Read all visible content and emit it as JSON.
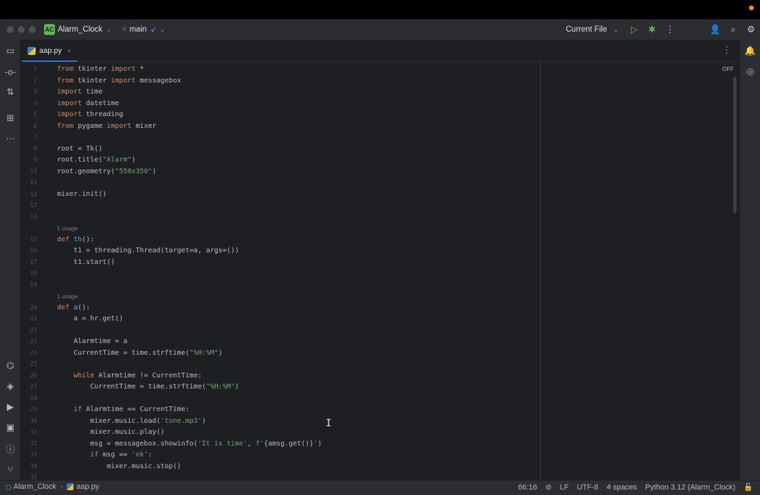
{
  "project": {
    "badge": "AC",
    "name": "Alarm_Clock"
  },
  "vcs": {
    "branch": "main"
  },
  "run_config": {
    "label": "Current File"
  },
  "tab": {
    "filename": "aap.py",
    "close": "×"
  },
  "editor": {
    "off_label": "OFF",
    "usage_hint": "1 usage",
    "lines": [
      {
        "n": "1",
        "html": "<span class='kw'>from</span> tkinter <span class='kw'>import</span> *"
      },
      {
        "n": "2",
        "html": "<span class='kw'>from</span> tkinter <span class='kw'>import</span> messagebox"
      },
      {
        "n": "3",
        "html": "<span class='kw'>import</span> time"
      },
      {
        "n": "4",
        "html": "<span class='kw'>import</span> datetime"
      },
      {
        "n": "5",
        "html": "<span class='kw'>import</span> threading"
      },
      {
        "n": "6",
        "html": "<span class='kw'>from</span> pygame <span class='kw'>import</span> mixer"
      },
      {
        "n": "7",
        "html": ""
      },
      {
        "n": "8",
        "html": "root = Tk()"
      },
      {
        "n": "9",
        "html": "root.title(<span class='str'>\"Alarm\"</span>)"
      },
      {
        "n": "10",
        "html": "root.geometry(<span class='str'>\"550x350\"</span>)"
      },
      {
        "n": "11",
        "html": ""
      },
      {
        "n": "12",
        "html": "mixer.init()"
      },
      {
        "n": "13",
        "html": ""
      },
      {
        "n": "14",
        "html": ""
      },
      {
        "n": "",
        "hint": true
      },
      {
        "n": "15",
        "html": "<span class='kw'>def</span> <span class='fn'>th</span>():"
      },
      {
        "n": "16",
        "html": "    t1 = threading.Thread(target=a, args=())"
      },
      {
        "n": "17",
        "html": "    t1.start()"
      },
      {
        "n": "18",
        "html": ""
      },
      {
        "n": "19",
        "html": ""
      },
      {
        "n": "",
        "hint": true
      },
      {
        "n": "20",
        "html": "<span class='kw'>def</span> <span class='fn'>a</span>():"
      },
      {
        "n": "21",
        "html": "    a = hr.get()"
      },
      {
        "n": "22",
        "html": ""
      },
      {
        "n": "23",
        "html": "    Alarmtime = a"
      },
      {
        "n": "24",
        "html": "    CurrentTime = time.strftime(<span class='str'>\"%H:%M\"</span>)"
      },
      {
        "n": "25",
        "html": ""
      },
      {
        "n": "26",
        "html": "    <span class='kw'>while</span> Alarmtime != CurrentTime:"
      },
      {
        "n": "27",
        "html": "        CurrentTime = time.strftime(<span class='str'>\"%H:%M\"</span>)"
      },
      {
        "n": "28",
        "html": ""
      },
      {
        "n": "29",
        "html": "    <span class='kw'>if</span> Alarmtime == CurrentTime:"
      },
      {
        "n": "30",
        "html": "        mixer.music.load(<span class='str'>'tone.mp3'</span>)"
      },
      {
        "n": "31",
        "html": "        mixer.music.play()"
      },
      {
        "n": "32",
        "html": "        msg = messagebox.showinfo(<span class='str'>'It is time'</span>, <span class='str'>f'</span>{amsg.get()}<span class='str'>'</span>)"
      },
      {
        "n": "33",
        "html": "        <span class='kw'>if</span> msg == <span class='str'>'ok'</span>:"
      },
      {
        "n": "34",
        "html": "            mixer.music.stop()"
      },
      {
        "n": "35",
        "html": ""
      }
    ]
  },
  "statusbar": {
    "crumb_project": "Alarm_Clock",
    "crumb_file": "aap.py",
    "position": "66:16",
    "line_ending": "LF",
    "encoding": "UTF-8",
    "indent": "4 spaces",
    "interpreter": "Python 3.12 (Alarm_Clock)"
  },
  "colors": {
    "accent": "#3574f0",
    "keyword": "#cf8e6d",
    "string": "#6aab73",
    "function": "#56a8f5"
  }
}
